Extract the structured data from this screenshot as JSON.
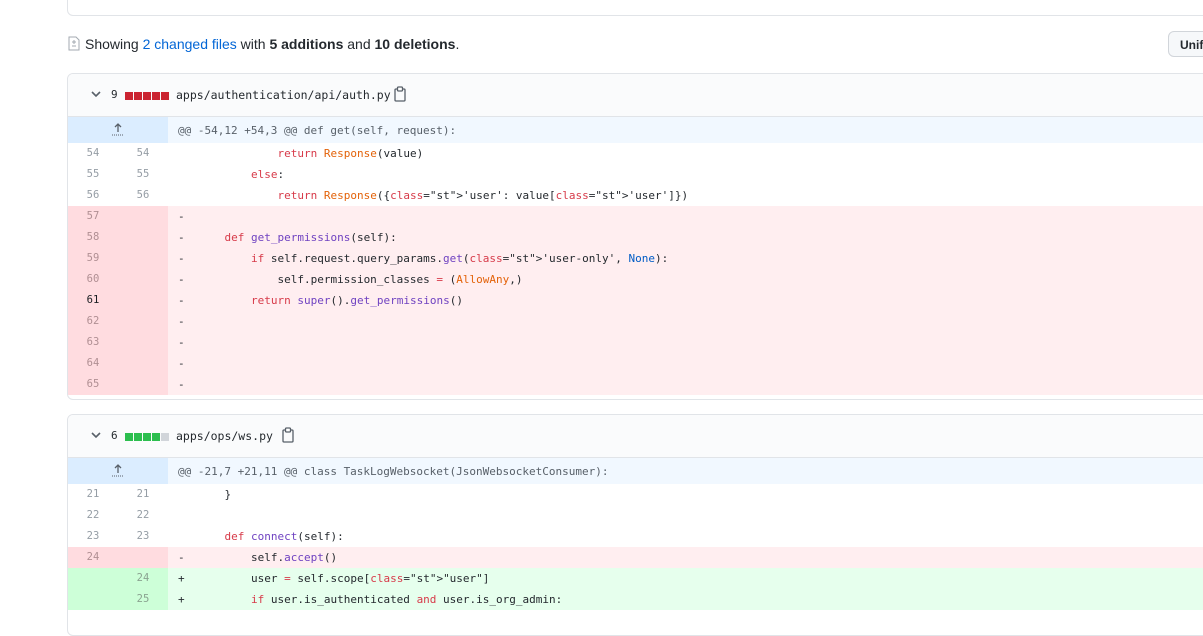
{
  "summary": {
    "showing": "Showing",
    "changed_files": "2 changed files",
    "with": "with",
    "additions": "5 additions",
    "and": "and",
    "deletions": "10 deletions",
    "period": "."
  },
  "view_toggle": {
    "label": "Unified"
  },
  "files": [
    {
      "changes": "9",
      "bar": [
        "del",
        "del",
        "del",
        "del",
        "del"
      ],
      "path": "apps/authentication/api/auth.py",
      "hunk": "@@ -54,12 +54,3 @@ def get(self, request):",
      "lines": [
        {
          "type": "ctx",
          "old": "54",
          "new": "54",
          "sign": " ",
          "code": "            return Response(value)"
        },
        {
          "type": "ctx",
          "old": "55",
          "new": "55",
          "sign": " ",
          "code": "        else:"
        },
        {
          "type": "ctx",
          "old": "56",
          "new": "56",
          "sign": " ",
          "code": "            return Response({'user': value['user']})"
        },
        {
          "type": "del",
          "old": "57",
          "new": "",
          "sign": "-",
          "code": ""
        },
        {
          "type": "del",
          "old": "58",
          "new": "",
          "sign": "-",
          "code": "    def get_permissions(self):"
        },
        {
          "type": "del",
          "old": "59",
          "new": "",
          "sign": "-",
          "code": "        if self.request.query_params.get('user-only', None):"
        },
        {
          "type": "del",
          "old": "60",
          "new": "",
          "sign": "-",
          "code": "            self.permission_classes = (AllowAny,)"
        },
        {
          "type": "del",
          "old": "61",
          "new": "",
          "sign": "-",
          "code": "        return super().get_permissions()"
        },
        {
          "type": "del",
          "old": "62",
          "new": "",
          "sign": "-",
          "code": ""
        },
        {
          "type": "del",
          "old": "63",
          "new": "",
          "sign": "-",
          "code": ""
        },
        {
          "type": "del",
          "old": "64",
          "new": "",
          "sign": "-",
          "code": ""
        },
        {
          "type": "del",
          "old": "65",
          "new": "",
          "sign": "-",
          "code": ""
        }
      ]
    },
    {
      "changes": "6",
      "bar": [
        "add",
        "add",
        "add",
        "add",
        "neutral"
      ],
      "path": "apps/ops/ws.py",
      "hunk": "@@ -21,7 +21,11 @@ class TaskLogWebsocket(JsonWebsocketConsumer):",
      "lines": [
        {
          "type": "ctx",
          "old": "21",
          "new": "21",
          "sign": " ",
          "code": "    }"
        },
        {
          "type": "ctx",
          "old": "22",
          "new": "22",
          "sign": " ",
          "code": ""
        },
        {
          "type": "ctx",
          "old": "23",
          "new": "23",
          "sign": " ",
          "code": "    def connect(self):"
        },
        {
          "type": "del",
          "old": "24",
          "new": "",
          "sign": "-",
          "code": "        self.accept()"
        },
        {
          "type": "add",
          "old": "",
          "new": "24",
          "sign": "+",
          "code": "        user = self.scope[\"user\"]"
        },
        {
          "type": "add",
          "old": "",
          "new": "25",
          "sign": "+",
          "code": "        if user.is_authenticated and user.is_org_admin:"
        }
      ]
    }
  ],
  "colors": {
    "deletion_bar": "#cb2431",
    "addition_bar": "#2cbe4e",
    "neutral_bar": "#d1d5da",
    "link": "#0366d6"
  }
}
